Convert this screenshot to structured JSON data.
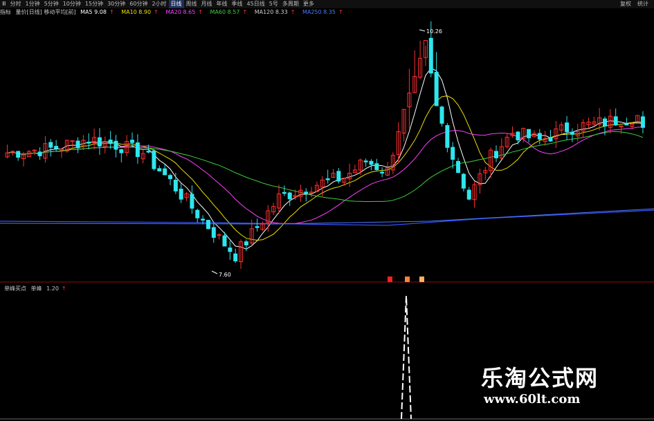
{
  "toolbar": {
    "items": [
      "Ⅲ",
      "分时",
      "1分钟",
      "5分钟",
      "10分钟",
      "15分钟",
      "30分钟",
      "60分钟",
      "2小时",
      "日线",
      "周线",
      "月线",
      "年线",
      "季线",
      "45日线",
      "5号",
      "多周期",
      "更多"
    ],
    "active": "日线",
    "right": [
      "复权",
      "统计"
    ]
  },
  "ma_bar": {
    "prefix": "指标",
    "formula": "量价[日线] 移动平均[前]",
    "ma5": "MA5 9.08",
    "ma10": "MA10 8.90",
    "ma20": "MA20 8.65",
    "ma60": "MA60 8.57",
    "ma120": "MA120 8.33",
    "ma250": "MA250 8.35"
  },
  "colors": {
    "up": "#ff3030",
    "down": "#2ee6ee",
    "ma5": "#ffffff",
    "ma10": "#f0e000",
    "ma20": "#ff40ff",
    "ma60": "#3cd23c",
    "ma120": "#3355ff",
    "ma250": "#4a78ff",
    "signal": "#ffffff"
  },
  "annotations": {
    "high": "10.26",
    "low": "7.60"
  },
  "indicator": {
    "name": "单峰买点",
    "label": "单峰",
    "value": "1.20"
  },
  "watermark": {
    "line1": "乐淘公式网",
    "line2": "www.60lt.com"
  },
  "chart_data": {
    "type": "candlestick",
    "ylim": [
      7.4,
      10.6
    ],
    "highest": 10.26,
    "lowest": 7.6
  }
}
